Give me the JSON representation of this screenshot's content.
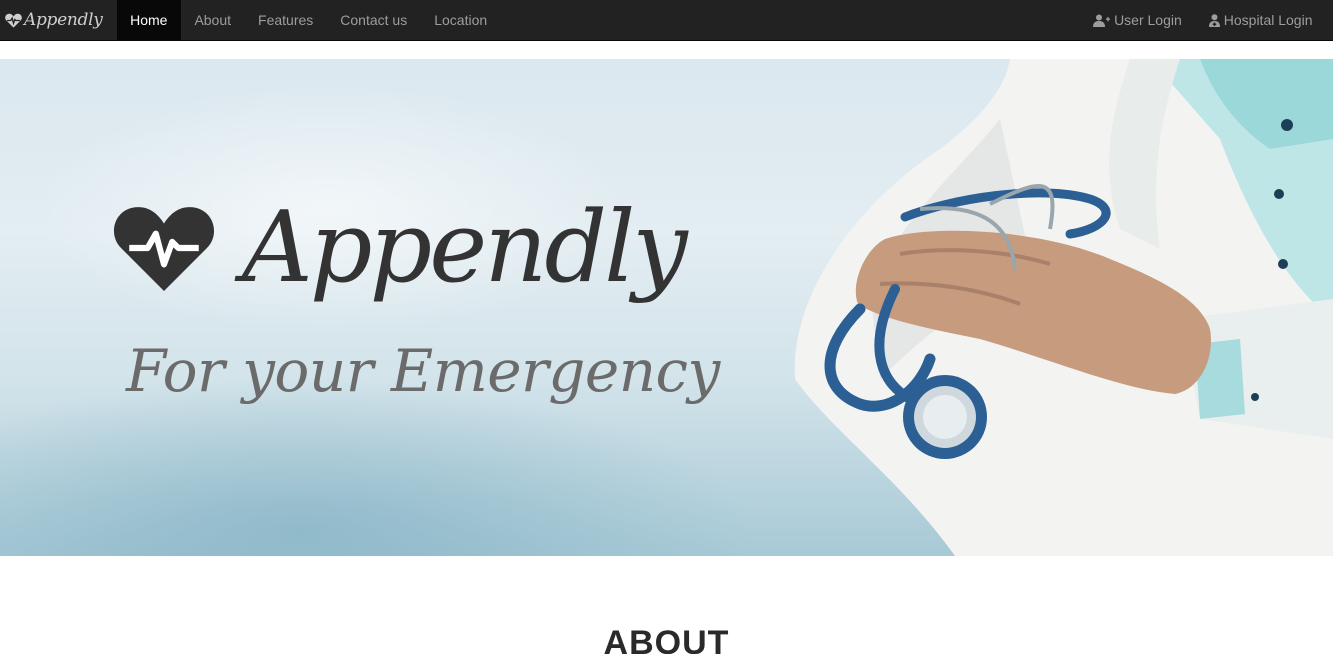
{
  "navbar": {
    "brand": "Appendly",
    "links": [
      {
        "label": "Home",
        "active": true
      },
      {
        "label": "About",
        "active": false
      },
      {
        "label": "Features",
        "active": false
      },
      {
        "label": "Contact us",
        "active": false
      },
      {
        "label": "Location",
        "active": false
      }
    ],
    "right_links": [
      {
        "label": "User Login",
        "icon": "user-plus-icon"
      },
      {
        "label": "Hospital Login",
        "icon": "user-md-icon"
      }
    ]
  },
  "hero": {
    "title": "Appendly",
    "subtitle": "For your Emergency",
    "logo_icon": "heart-pulse-icon",
    "image": "doctor-with-stethoscope"
  },
  "about": {
    "heading": "ABOUT"
  },
  "colors": {
    "navbar_bg": "#222222",
    "navbar_active_bg": "#080808",
    "navbar_link": "#9d9d9d",
    "hero_title": "#333333",
    "hero_subtitle": "#6b6b6b"
  }
}
